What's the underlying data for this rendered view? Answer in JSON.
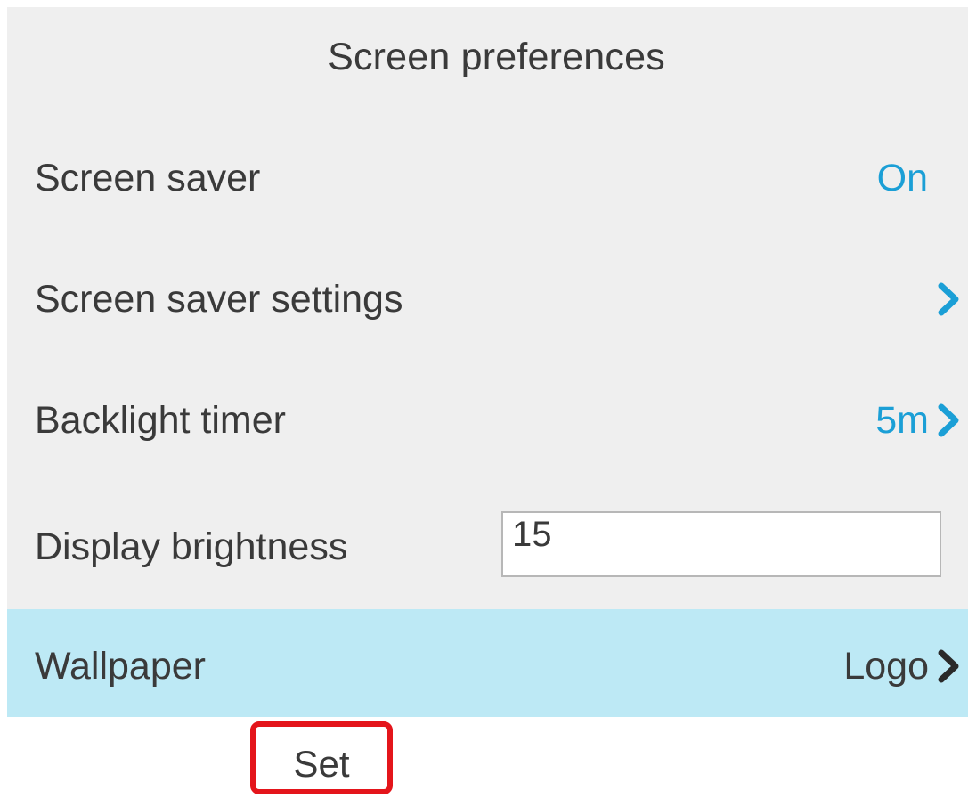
{
  "header": {
    "title": "Screen preferences"
  },
  "items": [
    {
      "label": "Screen saver",
      "value": "On"
    },
    {
      "label": "Screen saver settings",
      "value": ""
    },
    {
      "label": "Backlight timer",
      "value": "5m"
    },
    {
      "label": "Display brightness",
      "input_value": "15"
    },
    {
      "label": "Wallpaper",
      "value": "Logo",
      "selected": true
    }
  ],
  "softkeys": {
    "set_label": "Set"
  },
  "colors": {
    "accent": "#1b9fd6",
    "selected_row": "#bde9f5",
    "background": "#efefef",
    "text": "#3a3a3a",
    "highlight_border": "#e4151b"
  },
  "icons": {
    "chevron": "chevron-right-icon"
  }
}
